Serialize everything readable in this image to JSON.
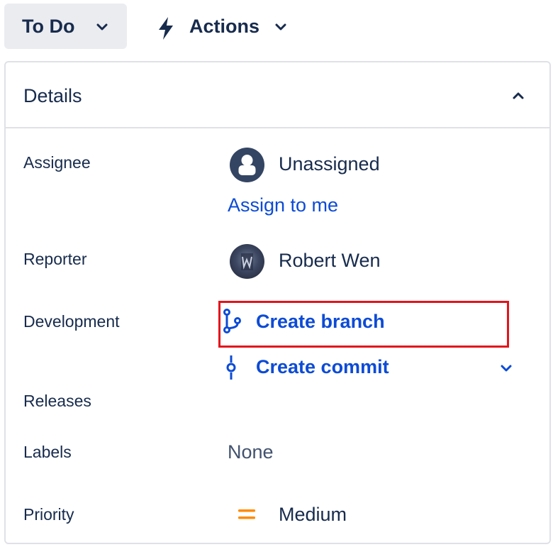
{
  "toolbar": {
    "status_label": "To Do",
    "actions_label": "Actions"
  },
  "details": {
    "title": "Details",
    "fields": {
      "assignee": {
        "label": "Assignee",
        "value": "Unassigned",
        "assign_link": "Assign to me"
      },
      "reporter": {
        "label": "Reporter",
        "value": "Robert Wen"
      },
      "development": {
        "label": "Development",
        "create_branch": "Create branch",
        "create_commit": "Create commit"
      },
      "releases": {
        "label": "Releases"
      },
      "labels": {
        "label": "Labels",
        "value": "None"
      },
      "priority": {
        "label": "Priority",
        "value": "Medium"
      }
    }
  },
  "icons": {
    "status_chevron": "chevron-down-icon",
    "actions": "lightning-bolt-icon",
    "actions_chevron": "chevron-down-icon",
    "collapse": "chevron-up-icon",
    "assignee_avatar": "default-user-avatar-icon",
    "branch": "git-branch-icon",
    "commit": "git-commit-icon",
    "development_expand": "chevron-down-icon",
    "priority": "priority-medium-icon"
  },
  "colors": {
    "link": "#0c4bd6",
    "text": "#172b4d",
    "button_bg": "#ebecf0",
    "border": "#dfe1e6",
    "priority_medium": "#ff8b00",
    "highlight": "#e3141b"
  }
}
